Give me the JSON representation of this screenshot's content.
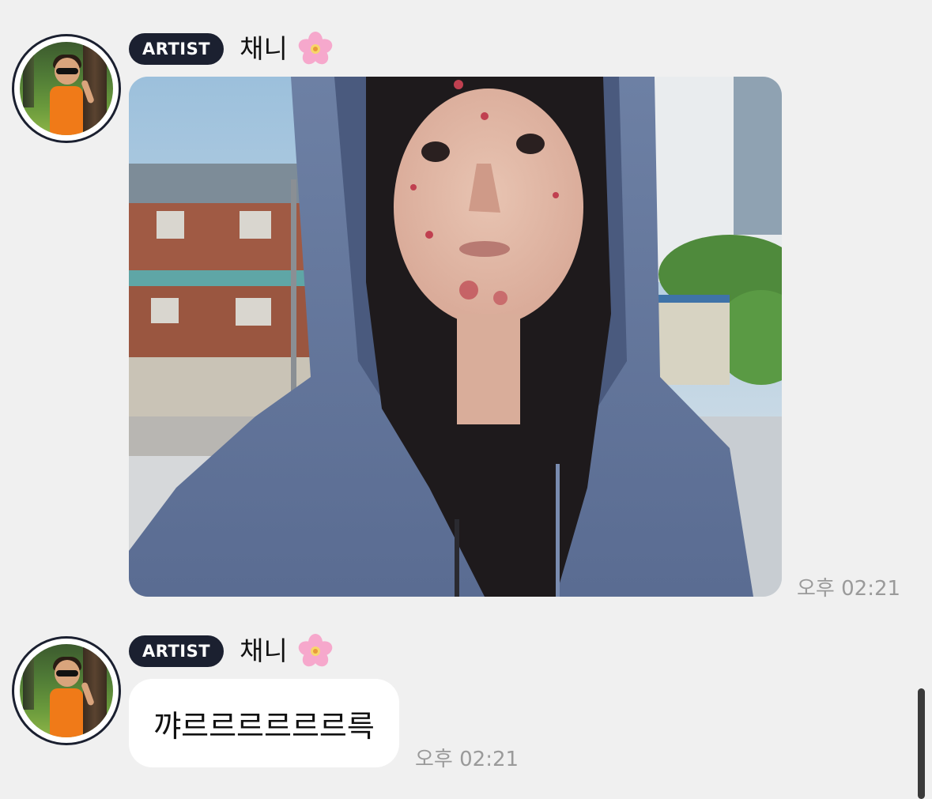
{
  "messages": [
    {
      "badge": "ARTIST",
      "sender": "채니",
      "sender_emoji_icon": "cherry-blossom-icon",
      "type": "photo",
      "photo_description_icon": "selfie-photo",
      "time": "오후 02:21"
    },
    {
      "badge": "ARTIST",
      "sender": "채니",
      "sender_emoji_icon": "cherry-blossom-icon",
      "type": "text",
      "text": "꺄르르르르르르륵",
      "time": "오후 02:21"
    }
  ],
  "colors": {
    "background": "#f0f0f0",
    "badge_bg": "#1b2030",
    "badge_text": "#ffffff",
    "bubble_bg": "#ffffff",
    "time_text": "#9a9a9a",
    "flower_pink": "#f29ac4"
  }
}
